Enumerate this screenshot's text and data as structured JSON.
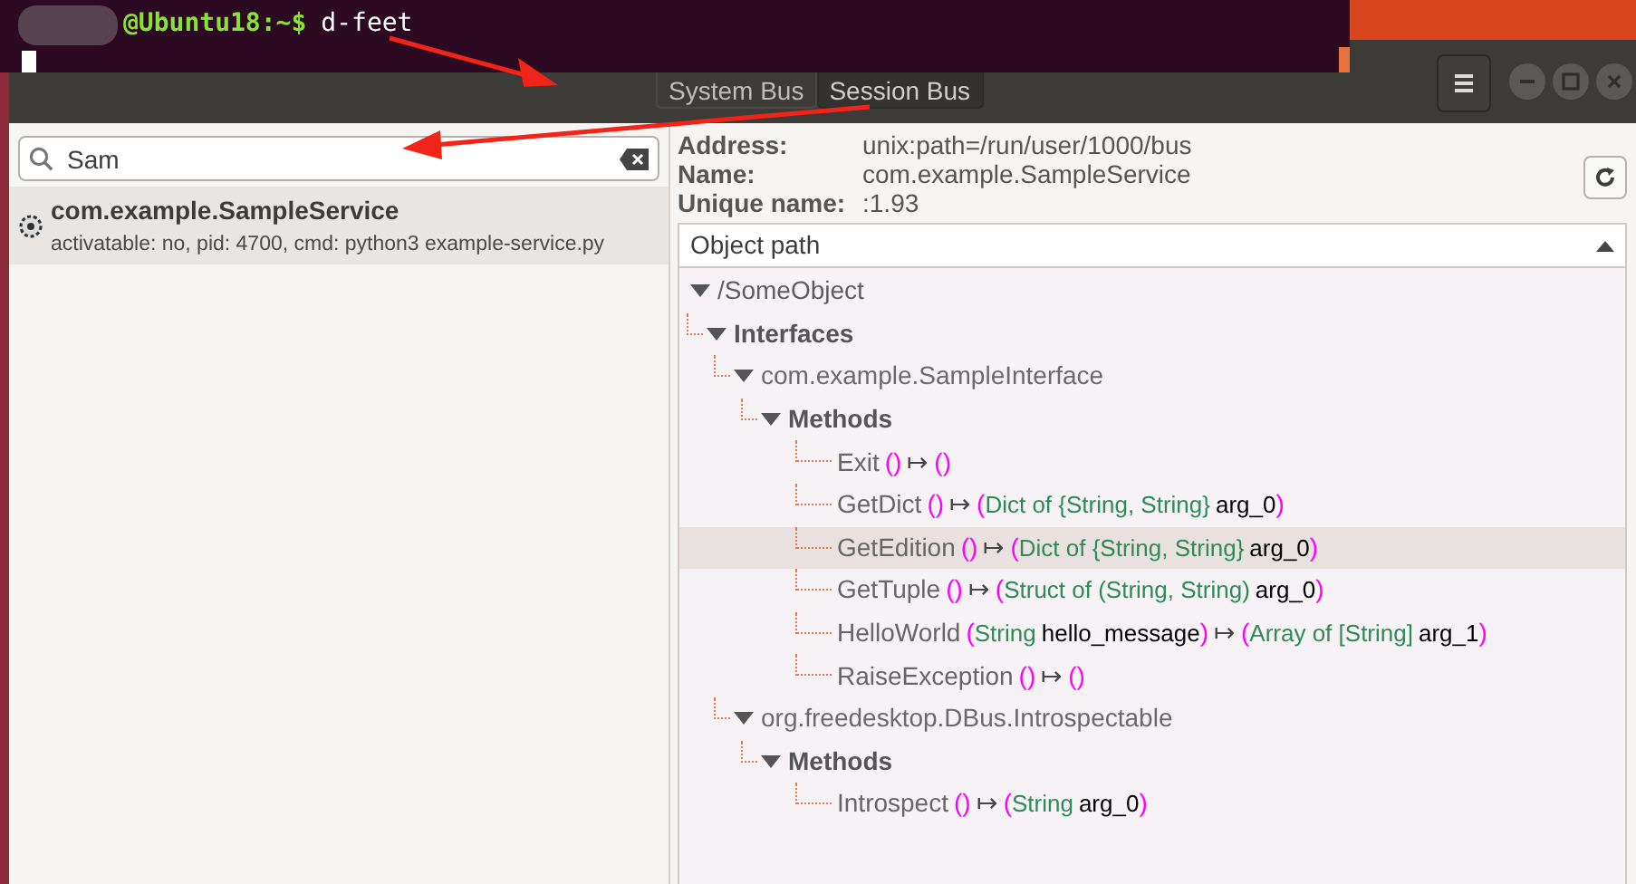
{
  "terminal": {
    "prompt": "@Ubuntu18:~$",
    "command": "d-feet"
  },
  "header": {
    "tabs": [
      {
        "label": "System Bus",
        "selected": false
      },
      {
        "label": "Session Bus",
        "selected": true
      }
    ]
  },
  "search": {
    "value": "Sam"
  },
  "services": [
    {
      "name": "com.example.SampleService",
      "details": "activatable: no, pid: 4700, cmd: python3 example-service.py",
      "selected": true
    }
  ],
  "info": [
    {
      "label": "Address:",
      "value": "unix:path=/run/user/1000/bus"
    },
    {
      "label": "Name:",
      "value": "com.example.SampleService"
    },
    {
      "label": "Unique name:",
      "value": ":1.93"
    }
  ],
  "object_path_header": "Object path",
  "tree": [
    {
      "kind": "object",
      "label": "/SomeObject",
      "expanded": true,
      "selected": false,
      "children": [
        {
          "kind": "group",
          "label": "Interfaces",
          "expanded": true,
          "selected": false,
          "children": [
            {
              "kind": "interface",
              "label": "com.example.SampleInterface",
              "expanded": true,
              "selected": false,
              "children": [
                {
                  "kind": "group",
                  "label": "Methods",
                  "expanded": true,
                  "selected": false,
                  "children": [
                    {
                      "kind": "method",
                      "selected": false,
                      "tokens": [
                        {
                          "kind": "name",
                          "text": "Exit"
                        },
                        {
                          "kind": "paren",
                          "text": "()"
                        },
                        {
                          "kind": "arrow",
                          "text": "↦"
                        },
                        {
                          "kind": "paren",
                          "text": "()"
                        }
                      ]
                    },
                    {
                      "kind": "method",
                      "selected": false,
                      "tokens": [
                        {
                          "kind": "name",
                          "text": "GetDict"
                        },
                        {
                          "kind": "paren",
                          "text": "()"
                        },
                        {
                          "kind": "arrow",
                          "text": "↦"
                        },
                        {
                          "kind": "paren",
                          "text": "("
                        },
                        {
                          "kind": "type",
                          "text": "Dict of {String, String}"
                        },
                        {
                          "kind": "arg",
                          "text": "arg_0"
                        },
                        {
                          "kind": "paren",
                          "text": ")"
                        }
                      ]
                    },
                    {
                      "kind": "method",
                      "selected": true,
                      "tokens": [
                        {
                          "kind": "name",
                          "text": "GetEdition"
                        },
                        {
                          "kind": "paren",
                          "text": "()"
                        },
                        {
                          "kind": "arrow",
                          "text": "↦"
                        },
                        {
                          "kind": "paren",
                          "text": "("
                        },
                        {
                          "kind": "type",
                          "text": "Dict of {String, String}"
                        },
                        {
                          "kind": "arg",
                          "text": "arg_0"
                        },
                        {
                          "kind": "paren",
                          "text": ")"
                        }
                      ]
                    },
                    {
                      "kind": "method",
                      "selected": false,
                      "tokens": [
                        {
                          "kind": "name",
                          "text": "GetTuple"
                        },
                        {
                          "kind": "paren",
                          "text": "()"
                        },
                        {
                          "kind": "arrow",
                          "text": "↦"
                        },
                        {
                          "kind": "paren",
                          "text": "("
                        },
                        {
                          "kind": "type",
                          "text": "Struct of (String, String)"
                        },
                        {
                          "kind": "arg",
                          "text": "arg_0"
                        },
                        {
                          "kind": "paren",
                          "text": ")"
                        }
                      ]
                    },
                    {
                      "kind": "method",
                      "selected": false,
                      "tokens": [
                        {
                          "kind": "name",
                          "text": "HelloWorld"
                        },
                        {
                          "kind": "paren",
                          "text": "("
                        },
                        {
                          "kind": "type",
                          "text": "String"
                        },
                        {
                          "kind": "arg",
                          "text": "hello_message"
                        },
                        {
                          "kind": "paren",
                          "text": ")"
                        },
                        {
                          "kind": "arrow",
                          "text": "↦"
                        },
                        {
                          "kind": "paren",
                          "text": "("
                        },
                        {
                          "kind": "type",
                          "text": "Array of [String]"
                        },
                        {
                          "kind": "arg",
                          "text": "arg_1"
                        },
                        {
                          "kind": "paren",
                          "text": ")"
                        }
                      ]
                    },
                    {
                      "kind": "method",
                      "selected": false,
                      "tokens": [
                        {
                          "kind": "name",
                          "text": "RaiseException"
                        },
                        {
                          "kind": "paren",
                          "text": "()"
                        },
                        {
                          "kind": "arrow",
                          "text": "↦"
                        },
                        {
                          "kind": "paren",
                          "text": "()"
                        }
                      ]
                    }
                  ]
                }
              ]
            },
            {
              "kind": "interface",
              "label": "org.freedesktop.DBus.Introspectable",
              "expanded": true,
              "selected": false,
              "children": [
                {
                  "kind": "group",
                  "label": "Methods",
                  "expanded": true,
                  "selected": false,
                  "children": [
                    {
                      "kind": "method",
                      "selected": false,
                      "tokens": [
                        {
                          "kind": "name",
                          "text": "Introspect"
                        },
                        {
                          "kind": "paren",
                          "text": "()"
                        },
                        {
                          "kind": "arrow",
                          "text": "↦"
                        },
                        {
                          "kind": "paren",
                          "text": "("
                        },
                        {
                          "kind": "type",
                          "text": "String"
                        },
                        {
                          "kind": "arg",
                          "text": "arg_0"
                        },
                        {
                          "kind": "paren",
                          "text": ")"
                        }
                      ]
                    }
                  ]
                }
              ]
            }
          ]
        }
      ]
    }
  ]
}
